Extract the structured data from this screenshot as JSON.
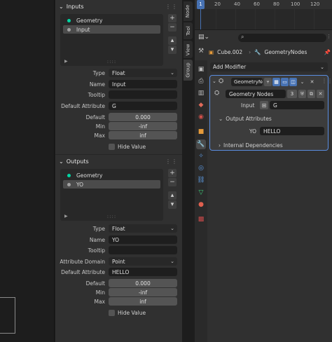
{
  "group_panel": {
    "inputs": {
      "header": "Inputs",
      "items": [
        {
          "label": "Geometry",
          "color": "#00d6a3"
        },
        {
          "label": "Input",
          "color": "#a1a1a1"
        }
      ],
      "props": {
        "type_label": "Type",
        "type_value": "Float",
        "name_label": "Name",
        "name_value": "Input",
        "tooltip_label": "Tooltip",
        "tooltip_value": "",
        "default_attr_label": "Default Attribute",
        "default_attr_value": "G",
        "default_label": "Default",
        "default_value": "0.000",
        "min_label": "Min",
        "min_value": "-inf",
        "max_label": "Max",
        "max_value": "inf",
        "hide_value_label": "Hide Value"
      }
    },
    "outputs": {
      "header": "Outputs",
      "items": [
        {
          "label": "Geometry",
          "color": "#00d6a3"
        },
        {
          "label": "YO",
          "color": "#a1a1a1"
        }
      ],
      "props": {
        "type_label": "Type",
        "type_value": "Float",
        "name_label": "Name",
        "name_value": "YO",
        "tooltip_label": "Tooltip",
        "tooltip_value": "",
        "attr_domain_label": "Attribute Domain",
        "attr_domain_value": "Point",
        "default_attr_label": "Default Attribute",
        "default_attr_value": "HELLO",
        "default_label": "Default",
        "default_value": "0.000",
        "min_label": "Min",
        "min_value": "-inf",
        "max_label": "Max",
        "max_value": "inf",
        "hide_value_label": "Hide Value"
      }
    }
  },
  "tabs": [
    "Node",
    "Tool",
    "View",
    "Group"
  ],
  "timeline": {
    "current_frame": "1",
    "frame_labels": [
      "20",
      "40",
      "60",
      "80",
      "100",
      "120"
    ]
  },
  "properties": {
    "search_placeholder": "",
    "object_name": "Cube.002",
    "modifier_tab": "GeometryNodes",
    "add_modifier": "Add Modifier",
    "modifier": {
      "name": "GeometryNodes",
      "node_group": "Geometry Nodes",
      "users": "3",
      "input_label": "Input",
      "input_value": "G",
      "output_attrs_label": "Output Attributes",
      "yo_label": "YO",
      "yo_value": "HELLO",
      "internal_deps_label": "Internal Dependencies"
    }
  },
  "colors": {
    "accent": "#4772b3",
    "geometry_socket": "#00d6a3",
    "float_socket": "#a1a1a1"
  }
}
